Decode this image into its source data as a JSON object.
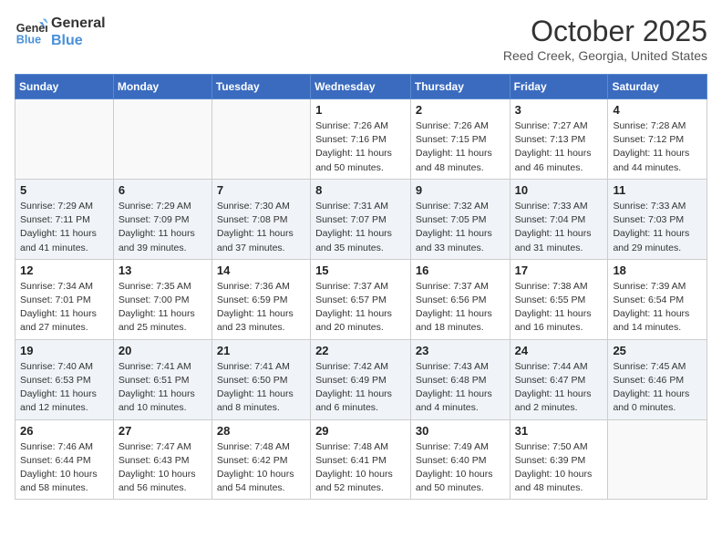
{
  "header": {
    "logo_line1": "General",
    "logo_line2": "Blue",
    "month": "October 2025",
    "location": "Reed Creek, Georgia, United States"
  },
  "weekdays": [
    "Sunday",
    "Monday",
    "Tuesday",
    "Wednesday",
    "Thursday",
    "Friday",
    "Saturday"
  ],
  "weeks": [
    [
      {
        "day": "",
        "info": ""
      },
      {
        "day": "",
        "info": ""
      },
      {
        "day": "",
        "info": ""
      },
      {
        "day": "1",
        "info": "Sunrise: 7:26 AM\nSunset: 7:16 PM\nDaylight: 11 hours\nand 50 minutes."
      },
      {
        "day": "2",
        "info": "Sunrise: 7:26 AM\nSunset: 7:15 PM\nDaylight: 11 hours\nand 48 minutes."
      },
      {
        "day": "3",
        "info": "Sunrise: 7:27 AM\nSunset: 7:13 PM\nDaylight: 11 hours\nand 46 minutes."
      },
      {
        "day": "4",
        "info": "Sunrise: 7:28 AM\nSunset: 7:12 PM\nDaylight: 11 hours\nand 44 minutes."
      }
    ],
    [
      {
        "day": "5",
        "info": "Sunrise: 7:29 AM\nSunset: 7:11 PM\nDaylight: 11 hours\nand 41 minutes."
      },
      {
        "day": "6",
        "info": "Sunrise: 7:29 AM\nSunset: 7:09 PM\nDaylight: 11 hours\nand 39 minutes."
      },
      {
        "day": "7",
        "info": "Sunrise: 7:30 AM\nSunset: 7:08 PM\nDaylight: 11 hours\nand 37 minutes."
      },
      {
        "day": "8",
        "info": "Sunrise: 7:31 AM\nSunset: 7:07 PM\nDaylight: 11 hours\nand 35 minutes."
      },
      {
        "day": "9",
        "info": "Sunrise: 7:32 AM\nSunset: 7:05 PM\nDaylight: 11 hours\nand 33 minutes."
      },
      {
        "day": "10",
        "info": "Sunrise: 7:33 AM\nSunset: 7:04 PM\nDaylight: 11 hours\nand 31 minutes."
      },
      {
        "day": "11",
        "info": "Sunrise: 7:33 AM\nSunset: 7:03 PM\nDaylight: 11 hours\nand 29 minutes."
      }
    ],
    [
      {
        "day": "12",
        "info": "Sunrise: 7:34 AM\nSunset: 7:01 PM\nDaylight: 11 hours\nand 27 minutes."
      },
      {
        "day": "13",
        "info": "Sunrise: 7:35 AM\nSunset: 7:00 PM\nDaylight: 11 hours\nand 25 minutes."
      },
      {
        "day": "14",
        "info": "Sunrise: 7:36 AM\nSunset: 6:59 PM\nDaylight: 11 hours\nand 23 minutes."
      },
      {
        "day": "15",
        "info": "Sunrise: 7:37 AM\nSunset: 6:57 PM\nDaylight: 11 hours\nand 20 minutes."
      },
      {
        "day": "16",
        "info": "Sunrise: 7:37 AM\nSunset: 6:56 PM\nDaylight: 11 hours\nand 18 minutes."
      },
      {
        "day": "17",
        "info": "Sunrise: 7:38 AM\nSunset: 6:55 PM\nDaylight: 11 hours\nand 16 minutes."
      },
      {
        "day": "18",
        "info": "Sunrise: 7:39 AM\nSunset: 6:54 PM\nDaylight: 11 hours\nand 14 minutes."
      }
    ],
    [
      {
        "day": "19",
        "info": "Sunrise: 7:40 AM\nSunset: 6:53 PM\nDaylight: 11 hours\nand 12 minutes."
      },
      {
        "day": "20",
        "info": "Sunrise: 7:41 AM\nSunset: 6:51 PM\nDaylight: 11 hours\nand 10 minutes."
      },
      {
        "day": "21",
        "info": "Sunrise: 7:41 AM\nSunset: 6:50 PM\nDaylight: 11 hours\nand 8 minutes."
      },
      {
        "day": "22",
        "info": "Sunrise: 7:42 AM\nSunset: 6:49 PM\nDaylight: 11 hours\nand 6 minutes."
      },
      {
        "day": "23",
        "info": "Sunrise: 7:43 AM\nSunset: 6:48 PM\nDaylight: 11 hours\nand 4 minutes."
      },
      {
        "day": "24",
        "info": "Sunrise: 7:44 AM\nSunset: 6:47 PM\nDaylight: 11 hours\nand 2 minutes."
      },
      {
        "day": "25",
        "info": "Sunrise: 7:45 AM\nSunset: 6:46 PM\nDaylight: 11 hours\nand 0 minutes."
      }
    ],
    [
      {
        "day": "26",
        "info": "Sunrise: 7:46 AM\nSunset: 6:44 PM\nDaylight: 10 hours\nand 58 minutes."
      },
      {
        "day": "27",
        "info": "Sunrise: 7:47 AM\nSunset: 6:43 PM\nDaylight: 10 hours\nand 56 minutes."
      },
      {
        "day": "28",
        "info": "Sunrise: 7:48 AM\nSunset: 6:42 PM\nDaylight: 10 hours\nand 54 minutes."
      },
      {
        "day": "29",
        "info": "Sunrise: 7:48 AM\nSunset: 6:41 PM\nDaylight: 10 hours\nand 52 minutes."
      },
      {
        "day": "30",
        "info": "Sunrise: 7:49 AM\nSunset: 6:40 PM\nDaylight: 10 hours\nand 50 minutes."
      },
      {
        "day": "31",
        "info": "Sunrise: 7:50 AM\nSunset: 6:39 PM\nDaylight: 10 hours\nand 48 minutes."
      },
      {
        "day": "",
        "info": ""
      }
    ]
  ]
}
